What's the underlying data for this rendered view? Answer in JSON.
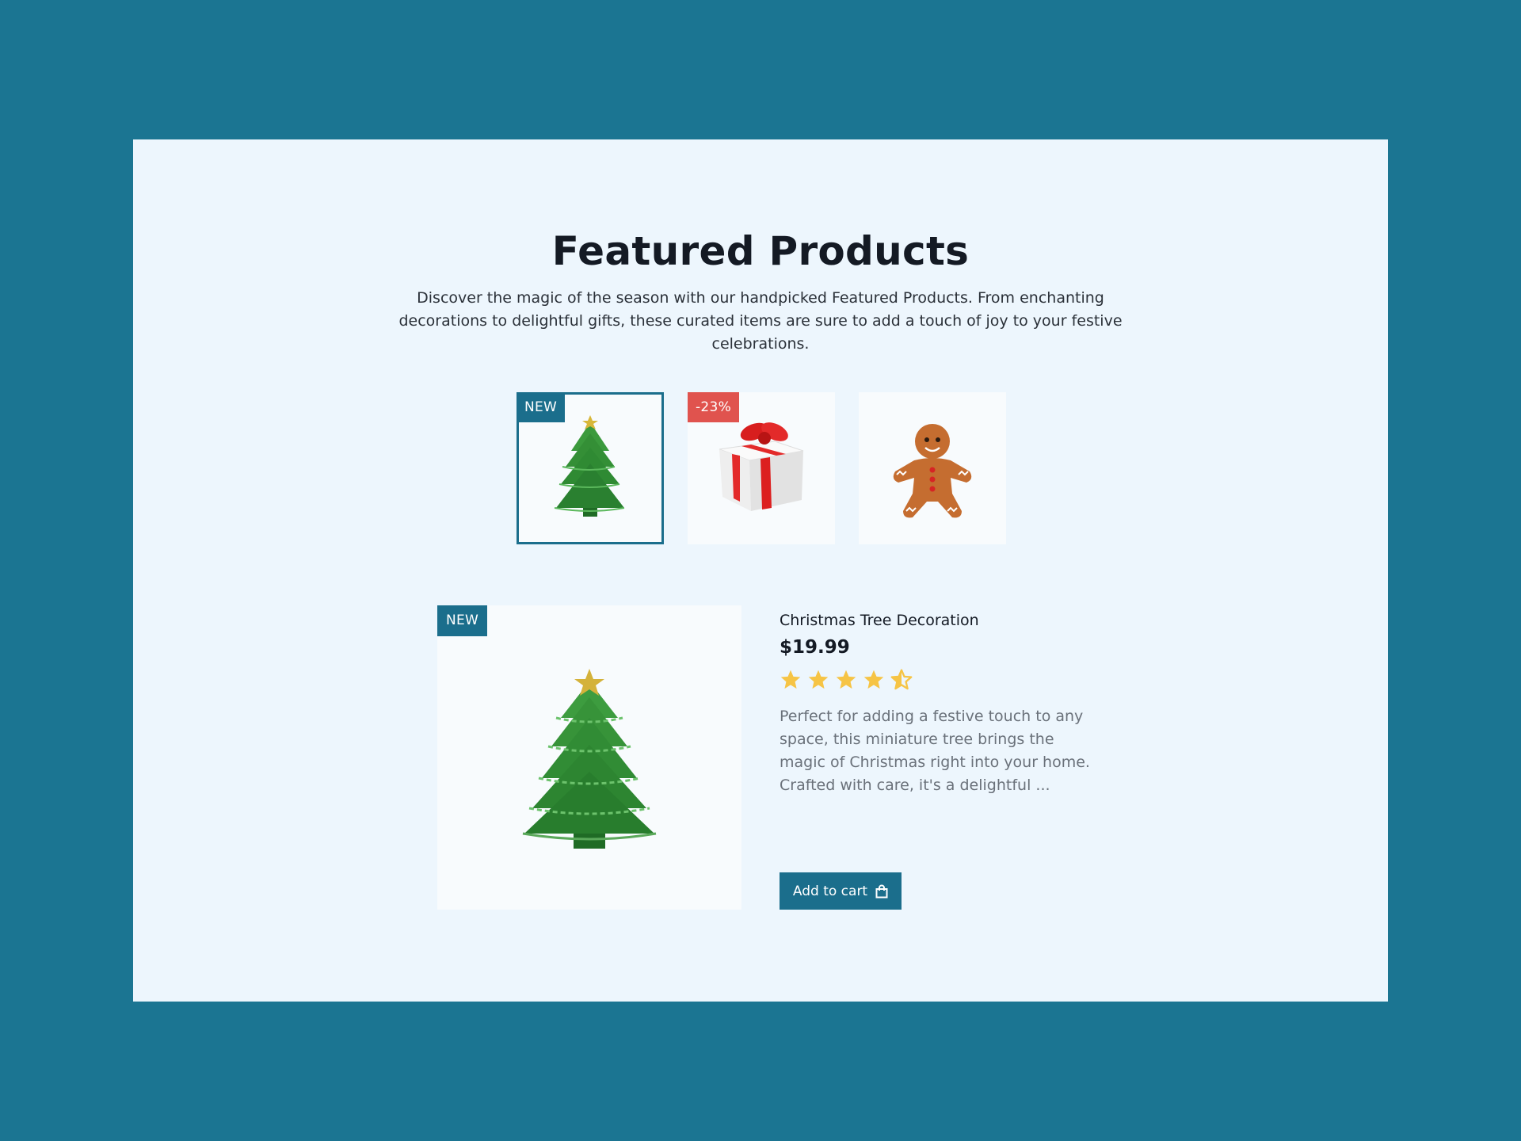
{
  "section": {
    "title": "Featured Products",
    "subtitle": "Discover the magic of the season with our handpicked Featured Products. From enchanting decorations to delightful gifts, these curated items are sure to add a touch of joy to your festive celebrations."
  },
  "thumbnails": [
    {
      "badge": "NEW",
      "icon": "christmas-tree-icon",
      "selected": true
    },
    {
      "badge": "-23%",
      "icon": "gift-box-icon",
      "selected": false
    },
    {
      "badge": "",
      "icon": "gingerbread-man-icon",
      "selected": false
    }
  ],
  "product": {
    "badge": "NEW",
    "name": "Christmas Tree Decoration",
    "price": "$19.99",
    "rating": 4.5,
    "rating_max": 5,
    "description": "Perfect for adding a festive touch to any space, this miniature tree brings the magic of Christmas right into your home. Crafted with care, it's a delightful ...",
    "add_to_cart_label": "Add to cart",
    "cart_icon": "shopping-bag-icon"
  },
  "colors": {
    "background": "#1b7592",
    "panel": "#edf6fd",
    "accent": "#1b6e8c",
    "sale_badge": "#e0534e",
    "star": "#f6c445"
  }
}
